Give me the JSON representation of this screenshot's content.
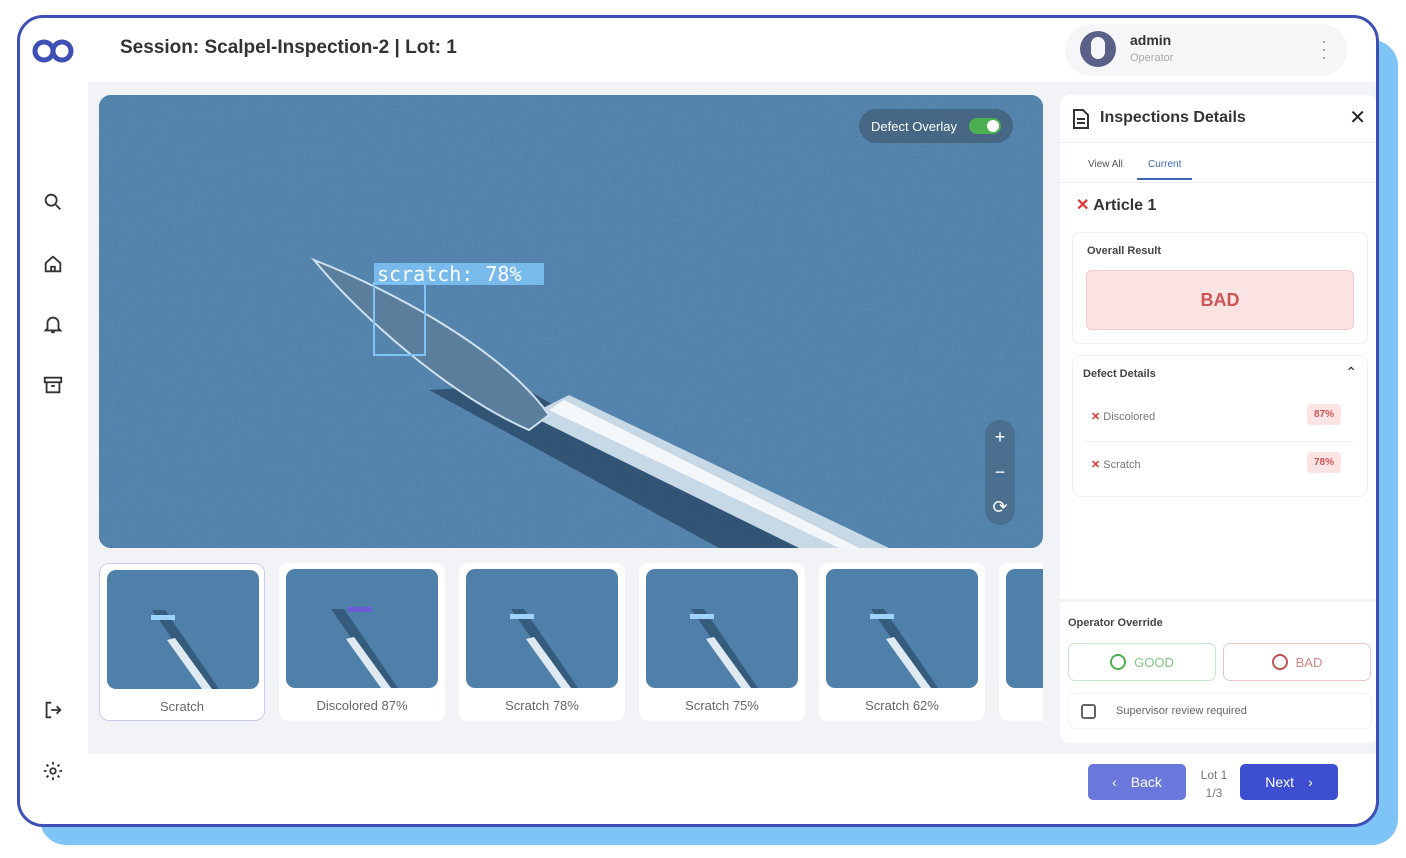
{
  "header": {
    "title": "Session: Scalpel-Inspection-2 | Lot: 1",
    "user_name": "admin",
    "user_role": "Operator"
  },
  "sidebar": {
    "items": [
      {
        "icon": "search-icon"
      },
      {
        "icon": "home-icon"
      },
      {
        "icon": "bell-icon"
      },
      {
        "icon": "archive-icon"
      },
      {
        "icon": "logout-icon"
      },
      {
        "icon": "gear-icon"
      }
    ]
  },
  "viewer": {
    "overlay_label": "Defect Overlay",
    "overlay_on": true,
    "detection_label": "scratch: 78%",
    "zoom_in": "+",
    "zoom_out": "−",
    "reset": "⟳"
  },
  "thumbnails": [
    {
      "label": "Scratch"
    },
    {
      "label": "Discolored 87%"
    },
    {
      "label": "Scratch 78%"
    },
    {
      "label": "Scratch 75%"
    },
    {
      "label": "Scratch 62%"
    }
  ],
  "panel": {
    "title": "Inspections Details",
    "close": "✕",
    "tabs": [
      "View All",
      "Current"
    ],
    "article": "Article 1",
    "overall_label": "Overall Result",
    "overall_value": "BAD",
    "defects_label": "Defect Details",
    "defects": [
      {
        "name": "Discolored",
        "score": "87%"
      },
      {
        "name": "Scratch",
        "score": "78%"
      }
    ],
    "override_label": "Operator Override",
    "good_label": "GOOD",
    "bad_label": "BAD",
    "supervisor_label": "Supervisor review required"
  },
  "footer": {
    "back": "Back",
    "next": "Next",
    "lot": "Lot 1",
    "page": "1/3"
  },
  "colors": {
    "brand": "#3e4fb5",
    "bad": "#c55",
    "good": "#4caf50"
  }
}
